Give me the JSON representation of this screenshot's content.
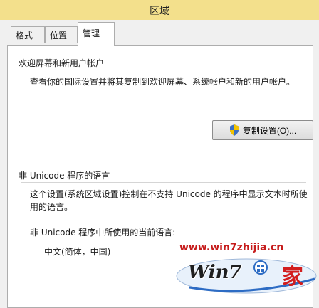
{
  "window": {
    "title": "区域"
  },
  "tabs": [
    {
      "label": "格式"
    },
    {
      "label": "位置"
    },
    {
      "label": "管理"
    }
  ],
  "welcome": {
    "heading": "欢迎屏幕和新用户帐户",
    "description": "查看你的国际设置并将其复制到欢迎屏幕、系统帐户和新的用户帐户。",
    "copy_button": "复制设置(O)..."
  },
  "non_unicode": {
    "heading": "非 Unicode 程序的语言",
    "description_line1": "这个设置(系统区域设置)控制在不支持 Unicode 的程序中显示文本时所使",
    "description_line2": "用的语言。",
    "current_label": "非 Unicode 程序中所使用的当前语言:",
    "current_value": "中文(简体，中国)"
  },
  "watermark": {
    "url": "www.win7zhijia.cn",
    "logo_text": "Win7",
    "logo_char": "家"
  },
  "colors": {
    "titlebar": "#f3e08c",
    "panel": "#ffffff",
    "watermark_red": "#c61c1c"
  }
}
